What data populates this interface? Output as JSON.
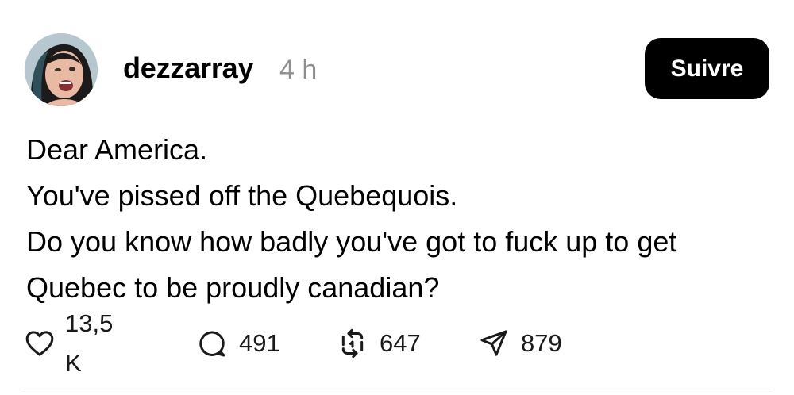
{
  "post": {
    "username": "dezzarray",
    "time": "4 h",
    "follow_label": "Suivre",
    "lines": [
      "Dear America.",
      "You've pissed off the Quebequois.",
      "Do you know how badly you've got to fuck up to get Quebec to be proudly canadian?"
    ]
  },
  "actions": {
    "likes": "13,5 K",
    "replies": "491",
    "reposts": "647",
    "shares": "879"
  },
  "icons": {
    "like": "heart-icon",
    "reply": "comment-bubble-icon",
    "repost": "repost-arrows-icon",
    "share": "send-paper-plane-icon"
  },
  "colors": {
    "follow_button_bg": "#000000",
    "follow_button_text": "#ffffff",
    "timestamp": "#8e8e8e",
    "text": "#000000"
  }
}
